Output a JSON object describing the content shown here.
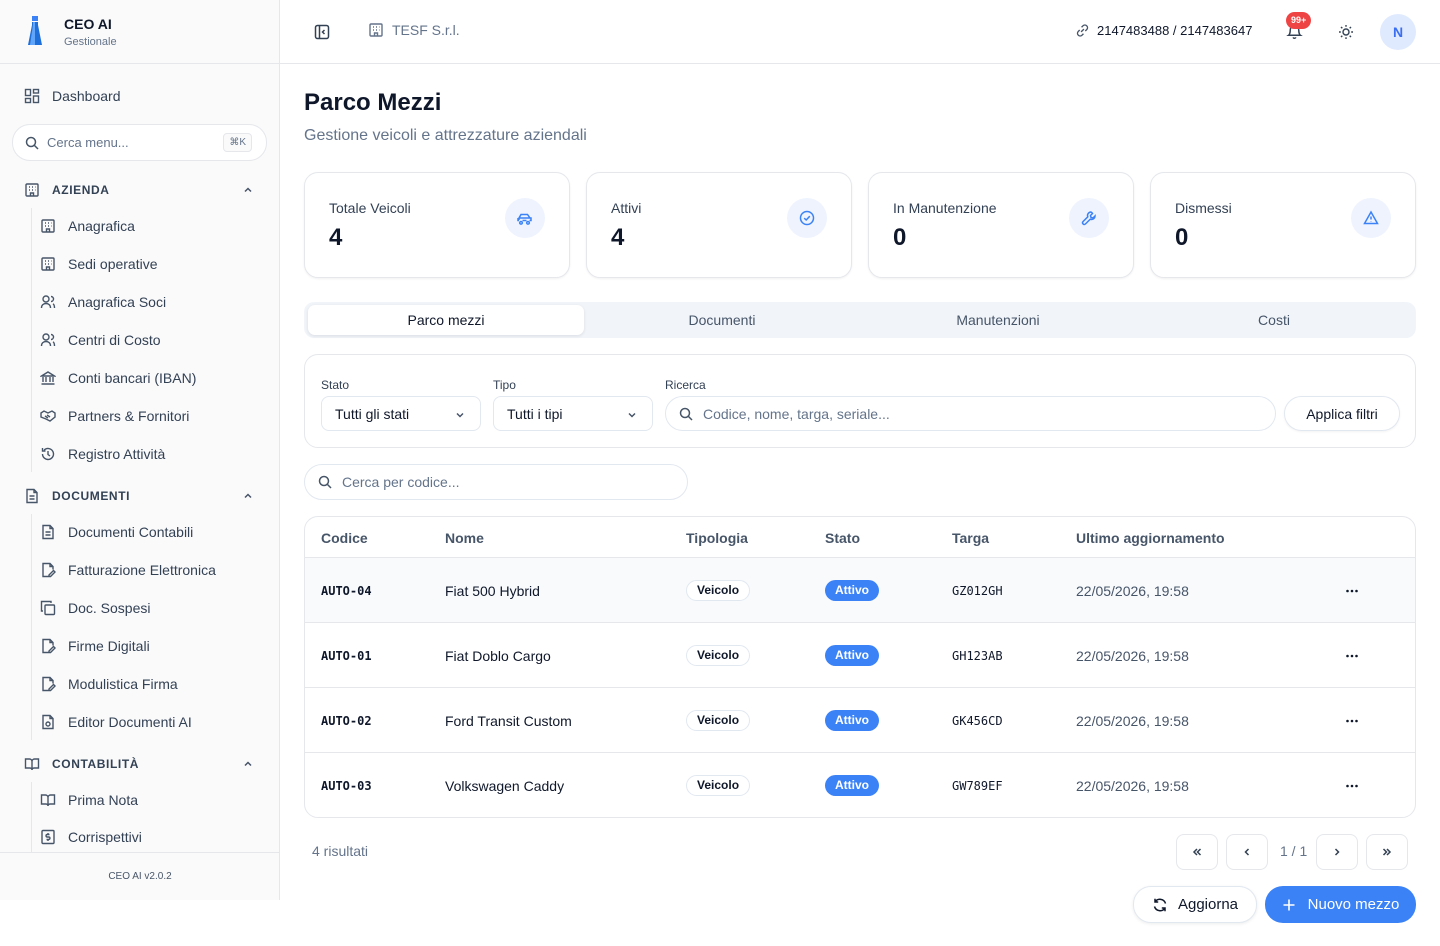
{
  "brand": {
    "title": "CEO AI",
    "subtitle": "Gestionale",
    "version": "CEO AI v2.0.2"
  },
  "sidebar": {
    "dashboard": "Dashboard",
    "search_placeholder": "Cerca menu...",
    "search_shortcut": "⌘K",
    "sections": [
      {
        "title": "AZIENDA",
        "items": [
          "Anagrafica",
          "Sedi operative",
          "Anagrafica Soci",
          "Centri di Costo",
          "Conti bancari (IBAN)",
          "Partners & Fornitori",
          "Registro Attività"
        ]
      },
      {
        "title": "DOCUMENTI",
        "items": [
          "Documenti Contabili",
          "Fatturazione Elettronica",
          "Doc. Sospesi",
          "Firme Digitali",
          "Modulistica Firma",
          "Editor Documenti AI"
        ]
      },
      {
        "title": "CONTABILITÀ",
        "items": [
          "Prima Nota",
          "Corrispettivi"
        ]
      }
    ]
  },
  "header": {
    "company": "TESF S.r.l.",
    "ids": "2147483488 / 2147483647",
    "notifications_badge": "99+",
    "avatar_initial": "N"
  },
  "page": {
    "title": "Parco Mezzi",
    "subtitle": "Gestione veicoli e attrezzature aziendali"
  },
  "stats": [
    {
      "label": "Totale Veicoli",
      "value": "4",
      "icon": "car-icon"
    },
    {
      "label": "Attivi",
      "value": "4",
      "icon": "check-circle-icon"
    },
    {
      "label": "In Manutenzione",
      "value": "0",
      "icon": "wrench-icon"
    },
    {
      "label": "Dismessi",
      "value": "0",
      "icon": "alert-triangle-icon"
    }
  ],
  "tabs": [
    "Parco mezzi",
    "Documenti",
    "Manutenzioni",
    "Costi"
  ],
  "active_tab": "Parco mezzi",
  "filters": {
    "stato_label": "Stato",
    "stato_value": "Tutti gli stati",
    "tipo_label": "Tipo",
    "tipo_value": "Tutti i tipi",
    "ricerca_label": "Ricerca",
    "ricerca_placeholder": "Codice, nome, targa, seriale...",
    "apply_label": "Applica filtri"
  },
  "code_search_placeholder": "Cerca per codice...",
  "table": {
    "columns": [
      "Codice",
      "Nome",
      "Tipologia",
      "Stato",
      "Targa",
      "Ultimo aggiornamento"
    ],
    "rows": [
      {
        "codice": "AUTO-04",
        "nome": "Fiat 500 Hybrid",
        "tipologia": "Veicolo",
        "stato": "Attivo",
        "targa": "GZ012GH",
        "aggiornamento": "22/05/2026, 19:58"
      },
      {
        "codice": "AUTO-01",
        "nome": "Fiat Doblo Cargo",
        "tipologia": "Veicolo",
        "stato": "Attivo",
        "targa": "GH123AB",
        "aggiornamento": "22/05/2026, 19:58"
      },
      {
        "codice": "AUTO-02",
        "nome": "Ford Transit Custom",
        "tipologia": "Veicolo",
        "stato": "Attivo",
        "targa": "GK456CD",
        "aggiornamento": "22/05/2026, 19:58"
      },
      {
        "codice": "AUTO-03",
        "nome": "Volkswagen Caddy",
        "tipologia": "Veicolo",
        "stato": "Attivo",
        "targa": "GW789EF",
        "aggiornamento": "22/05/2026, 19:58"
      }
    ]
  },
  "pagination": {
    "results": "4 risultati",
    "page_info": "1 / 1"
  },
  "actions": {
    "refresh": "Aggiorna",
    "new": "Nuovo mezzo"
  },
  "colors": {
    "accent": "#3b82f6",
    "badge": "#ef4444",
    "icon_bg": "#eef3fe"
  }
}
